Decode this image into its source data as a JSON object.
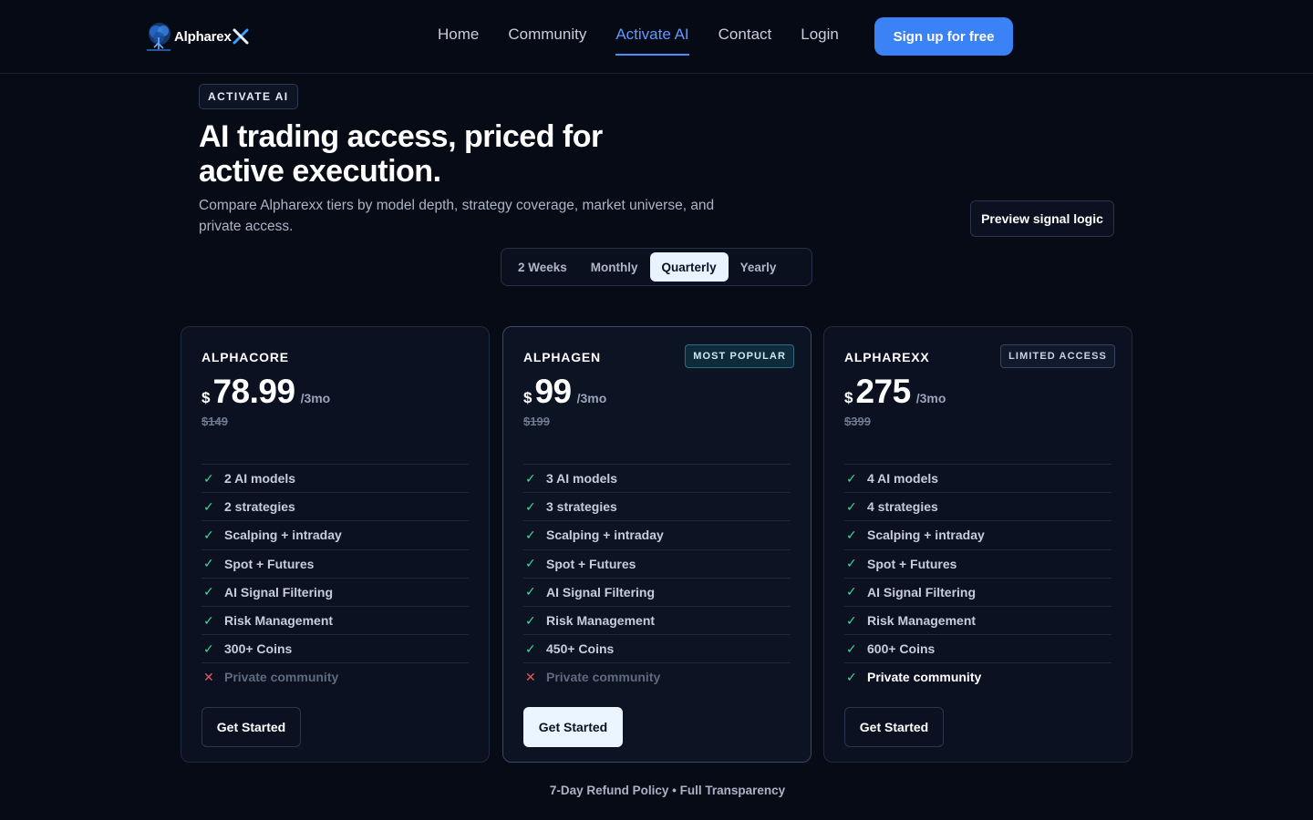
{
  "nav": {
    "brand": "Alpharex",
    "links": [
      {
        "label": "Home",
        "active": false
      },
      {
        "label": "Community",
        "active": false
      },
      {
        "label": "Activate AI",
        "active": true
      },
      {
        "label": "Contact",
        "active": false
      },
      {
        "label": "Login",
        "active": false
      }
    ],
    "signup_label": "Sign up for free"
  },
  "hero": {
    "eyebrow": "ACTIVATE AI",
    "headline_line1": "AI trading access, priced for",
    "headline_line2": "active execution.",
    "subtitle": "Compare Alpharexx tiers by model depth, strategy coverage, market universe, and private access.",
    "preview_label": "Preview signal logic"
  },
  "billing": {
    "options": [
      "2 Weeks",
      "Monthly",
      "Quarterly",
      "Yearly"
    ],
    "selected": "Quarterly"
  },
  "plans": [
    {
      "name": "ALPHACORE",
      "badge": "",
      "currency": "$",
      "price": "78.99",
      "period": "/3mo",
      "old_price": "$149",
      "features": [
        {
          "text": "2 AI models",
          "included": true
        },
        {
          "text": "2 strategies",
          "included": true
        },
        {
          "text": "Scalping + intraday",
          "included": true
        },
        {
          "text": "Spot + Futures",
          "included": true
        },
        {
          "text": "AI Signal Filtering",
          "included": true
        },
        {
          "text": "Risk Management",
          "included": true
        },
        {
          "text": "300+ Coins",
          "included": true
        },
        {
          "text": "Private community",
          "included": false
        }
      ],
      "cta": "Get Started"
    },
    {
      "name": "ALPHAGEN",
      "badge": "MOST POPULAR",
      "currency": "$",
      "price": "99",
      "period": "/3mo",
      "old_price": "$199",
      "features": [
        {
          "text": "3 AI models",
          "included": true
        },
        {
          "text": "3 strategies",
          "included": true
        },
        {
          "text": "Scalping + intraday",
          "included": true
        },
        {
          "text": "Spot + Futures",
          "included": true
        },
        {
          "text": "AI Signal Filtering",
          "included": true
        },
        {
          "text": "Risk Management",
          "included": true
        },
        {
          "text": "450+ Coins",
          "included": true
        },
        {
          "text": "Private community",
          "included": false
        }
      ],
      "cta": "Get Started"
    },
    {
      "name": "ALPHAREXX",
      "badge": "LIMITED ACCESS",
      "currency": "$",
      "price": "275",
      "period": "/3mo",
      "old_price": "$399",
      "features": [
        {
          "text": "4 AI models",
          "included": true
        },
        {
          "text": "4 strategies",
          "included": true
        },
        {
          "text": "Scalping + intraday",
          "included": true
        },
        {
          "text": "Spot + Futures",
          "included": true
        },
        {
          "text": "AI Signal Filtering",
          "included": true
        },
        {
          "text": "Risk Management",
          "included": true
        },
        {
          "text": "600+ Coins",
          "included": true
        },
        {
          "text": "Private community",
          "included": true
        }
      ],
      "cta": "Get Started"
    }
  ],
  "marks": {
    "check": "✓",
    "cross": "✕"
  },
  "footer_note": "7-Day Refund Policy • Full Transparency",
  "colors": {
    "background": "#070b16",
    "accent": "#3b82f6",
    "active_link": "#5d9bff",
    "check": "#3ddc97",
    "cross": "#e25b5b",
    "popular_badge": "#2f6b86"
  }
}
